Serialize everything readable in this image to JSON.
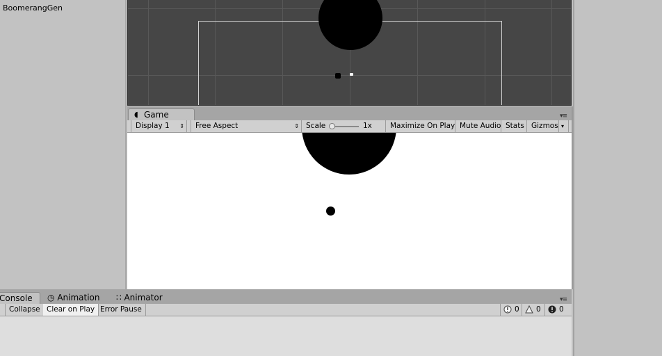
{
  "hierarchy": {
    "items": [
      "BoomerangGen"
    ]
  },
  "game": {
    "tab_label": "Game",
    "toolbar": {
      "display": "Display 1",
      "aspect": "Free Aspect",
      "scale_label": "Scale",
      "scale_value": "1x",
      "maximize": "Maximize On Play",
      "mute": "Mute Audio",
      "stats": "Stats",
      "gizmos": "Gizmos"
    }
  },
  "bottom_tabs": {
    "console": "Console",
    "animation": "Animation",
    "animator": "Animator"
  },
  "console": {
    "buttons": {
      "clear": "",
      "collapse": "Collapse",
      "clear_on_play": "Clear on Play",
      "error_pause": "Error Pause"
    },
    "counts": {
      "info": "0",
      "warning": "0",
      "error": "0"
    }
  },
  "icons": {
    "panel_menu": "panel-menu-icon",
    "game_tab": "pacman-icon",
    "animation": "clock-icon",
    "animator": "nodes-icon",
    "info": "info-icon",
    "warning": "warning-icon",
    "error": "error-icon"
  }
}
